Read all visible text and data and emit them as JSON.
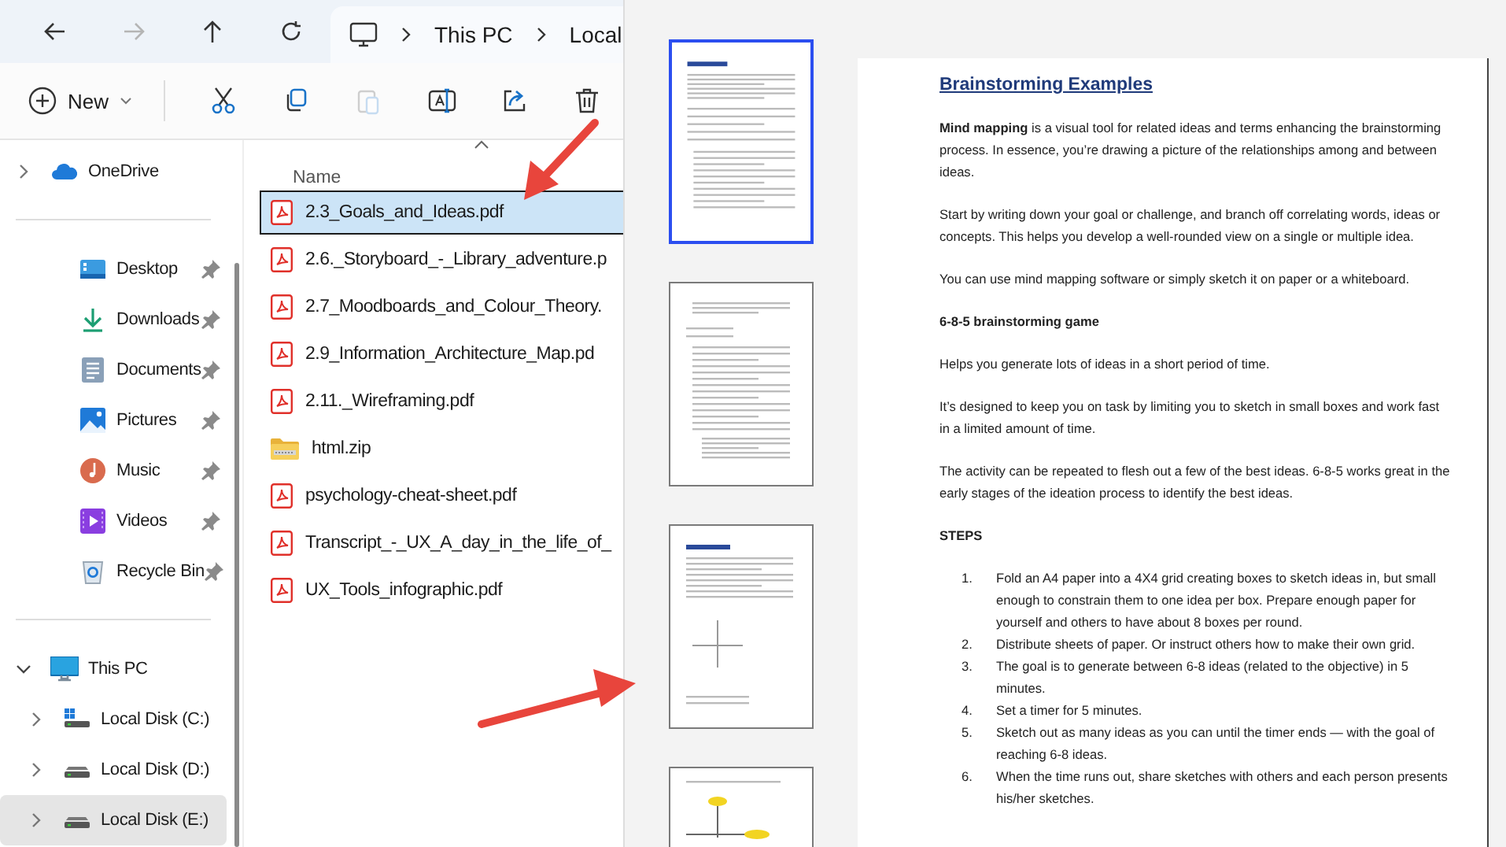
{
  "nav_buttons": [
    {
      "kind": "back",
      "disabled": false
    },
    {
      "kind": "forward",
      "disabled": true
    },
    {
      "kind": "up",
      "disabled": false
    },
    {
      "kind": "refresh",
      "disabled": false
    }
  ],
  "address_bar": {
    "crumbs": [
      "This PC",
      "Local"
    ]
  },
  "toolbar": {
    "new_label": "New",
    "actions": [
      {
        "kind": "cut",
        "disabled": false
      },
      {
        "kind": "copy",
        "disabled": false
      },
      {
        "kind": "paste",
        "disabled": true
      },
      {
        "kind": "rename",
        "disabled": false
      },
      {
        "kind": "share",
        "disabled": false
      },
      {
        "kind": "delete",
        "disabled": false
      }
    ]
  },
  "sidebar": {
    "sections": [
      {
        "items": [
          {
            "label": "OneDrive",
            "kind": "cloud",
            "expanded": false,
            "selected": false
          }
        ]
      },
      {
        "items": [
          {
            "label": "Desktop",
            "kind": "desktop",
            "pinned": true,
            "selected": false
          },
          {
            "label": "Downloads",
            "kind": "downloads",
            "pinned": true,
            "selected": false
          },
          {
            "label": "Documents",
            "kind": "documents",
            "pinned": true,
            "selected": false
          },
          {
            "label": "Pictures",
            "kind": "pictures",
            "pinned": true,
            "selected": false
          },
          {
            "label": "Music",
            "kind": "music",
            "pinned": true,
            "selected": false
          },
          {
            "label": "Videos",
            "kind": "videos",
            "pinned": true,
            "selected": false
          },
          {
            "label": "Recycle Bin",
            "kind": "recycle",
            "pinned": true,
            "selected": false
          }
        ]
      },
      {
        "items": [
          {
            "label": "This PC",
            "kind": "pc",
            "expanded": true,
            "selected": false,
            "children": [
              {
                "label": "Local Disk (C:)",
                "kind": "system_drive",
                "expanded": false,
                "selected": false
              },
              {
                "label": "Local Disk (D:)",
                "kind": "drive",
                "expanded": false,
                "selected": false
              },
              {
                "label": "Local Disk (E:)",
                "kind": "drive",
                "expanded": false,
                "selected": true
              }
            ]
          }
        ]
      }
    ]
  },
  "file_list": {
    "column": "Name",
    "files": [
      {
        "name": "2.3_Goals_and_Ideas.pdf",
        "kind": "pdf",
        "selected": true
      },
      {
        "name": "2.6._Storyboard_-_Library_adventure.p",
        "kind": "pdf",
        "selected": false
      },
      {
        "name": "2.7_Moodboards_and_Colour_Theory.",
        "kind": "pdf",
        "selected": false
      },
      {
        "name": "2.9_Information_Architecture_Map.pd",
        "kind": "pdf",
        "selected": false
      },
      {
        "name": "2.11._Wireframing.pdf",
        "kind": "pdf",
        "selected": false
      },
      {
        "name": "html.zip",
        "kind": "zip",
        "selected": false
      },
      {
        "name": "psychology-cheat-sheet.pdf",
        "kind": "pdf",
        "selected": false
      },
      {
        "name": "Transcript_-_UX_A_day_in_the_life_of_",
        "kind": "pdf",
        "selected": false
      },
      {
        "name": "UX_Tools_infographic.pdf",
        "kind": "pdf",
        "selected": false
      }
    ]
  },
  "preview": {
    "thumbnails": [
      {
        "kind": "text",
        "selected": true
      },
      {
        "kind": "list",
        "selected": false
      },
      {
        "kind": "diagram",
        "selected": false
      },
      {
        "kind": "mindmap",
        "selected": false
      }
    ],
    "document": {
      "title": "Brainstorming Examples",
      "blocks": [
        {
          "kind": "paragraph",
          "text": "**Mind mapping** is a visual tool for related ideas and terms enhancing the brainstorming process. In essence, you’re drawing a picture of the relationships among and between ideas."
        },
        {
          "kind": "paragraph",
          "text": "Start by writing down your goal or challenge, and branch off correlating words, ideas or concepts. This helps you develop a well-rounded view on a single or multiple idea."
        },
        {
          "kind": "paragraph",
          "text": "You can use mind mapping software or simply sketch it on paper or a whiteboard."
        },
        {
          "kind": "heading",
          "text": "6-8-5 brainstorming game"
        },
        {
          "kind": "paragraph",
          "text": "Helps you generate lots of ideas in a short period of time."
        },
        {
          "kind": "paragraph",
          "text": "It’s designed to keep you on task by limiting you to sketch in small boxes and work fast in a limited amount of time."
        },
        {
          "kind": "paragraph",
          "text": "The activity can be repeated to flesh out a few of the best ideas.  6-8-5 works great in the early stages of the ideation process to identify the best ideas."
        },
        {
          "kind": "heading",
          "text": "STEPS"
        },
        {
          "kind": "list",
          "items": [
            {
              "number": "1.",
              "text": "Fold an A4 paper into a 4X4 grid creating boxes to sketch ideas in, but small enough to constrain them to one idea per box. Prepare enough paper for yourself and others to have about 8 boxes per round."
            },
            {
              "number": "2.",
              "text": "Distribute sheets of paper. Or instruct others how to make their own grid."
            },
            {
              "number": "3.",
              "text": "The goal is to generate between 6-8 ideas (related to the objective) in 5 minutes."
            },
            {
              "number": "4.",
              "text": "Set a timer for 5 minutes."
            },
            {
              "number": "5.",
              "text": "Sketch out as many ideas as you can until the timer ends — with the goal of reaching 6-8 ideas."
            },
            {
              "number": "6.",
              "text": "When the time runs out, share sketches with others and each person presents his/her sketches."
            }
          ]
        }
      ]
    }
  }
}
